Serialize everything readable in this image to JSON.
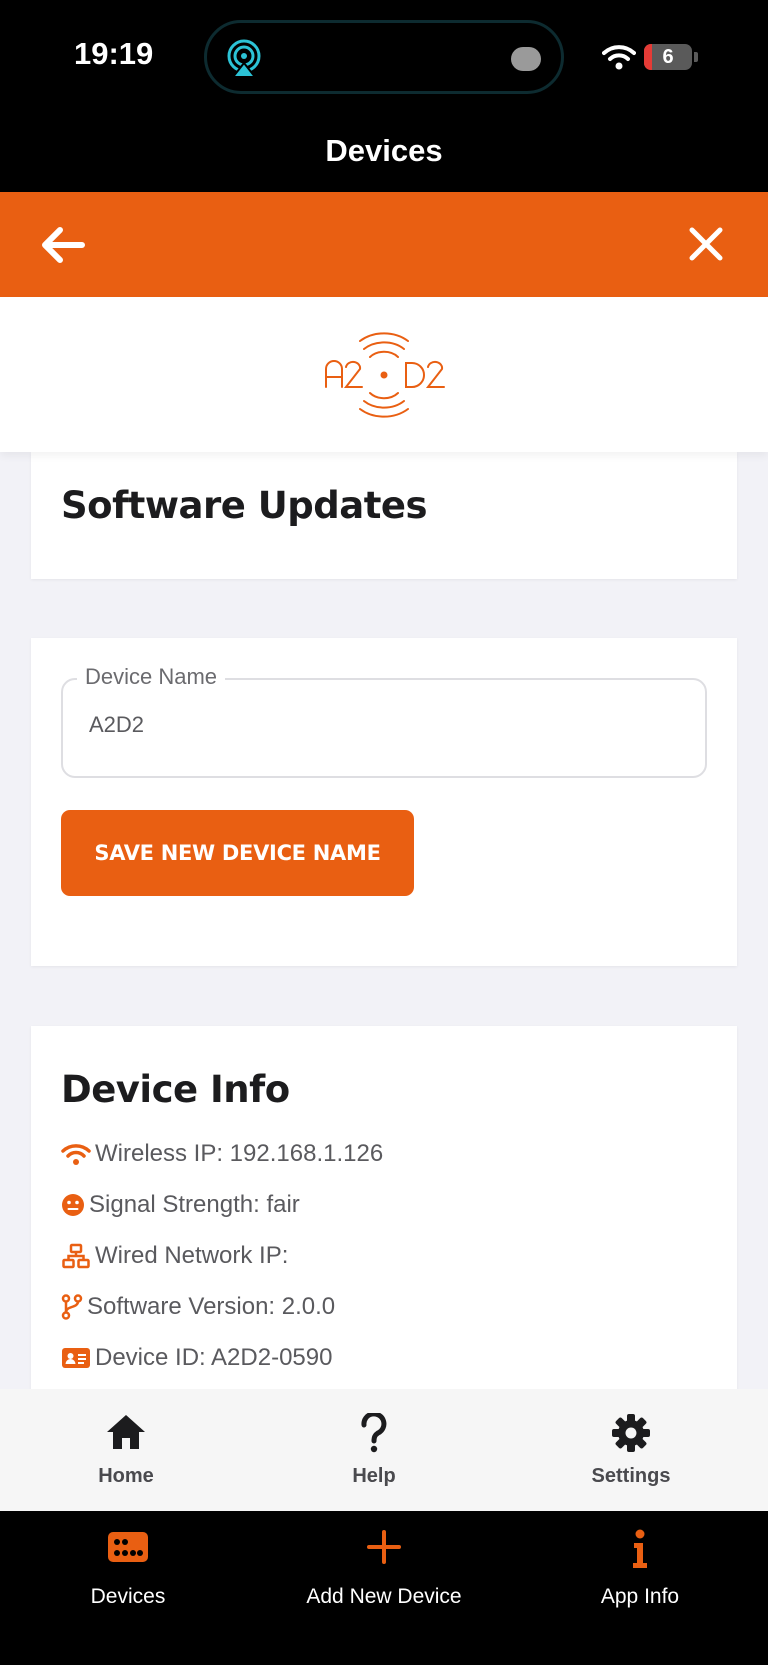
{
  "status_bar": {
    "time": "19:19",
    "battery": "6"
  },
  "header": {
    "title": "Devices"
  },
  "software_updates": {
    "title": "Software Updates"
  },
  "device_name": {
    "label": "Device Name",
    "value": "A2D2",
    "save_button": "SAVE NEW DEVICE NAME"
  },
  "device_info": {
    "title": "Device Info",
    "rows": [
      {
        "icon": "wifi-icon",
        "text": "Wireless IP: 192.168.1.126"
      },
      {
        "icon": "face-meh-icon",
        "text": "Signal Strength: fair"
      },
      {
        "icon": "network-icon",
        "text": "Wired Network IP:"
      },
      {
        "icon": "code-branch-icon",
        "text": "Software Version: 2.0.0"
      },
      {
        "icon": "id-card-icon",
        "text": "Device ID: A2D2-0590"
      }
    ]
  },
  "inner_tabs": [
    {
      "label": "Home",
      "icon": "home-icon"
    },
    {
      "label": "Help",
      "icon": "question-icon"
    },
    {
      "label": "Settings",
      "icon": "gear-icon"
    }
  ],
  "app_tabs": [
    {
      "label": "Devices",
      "icon": "devices-icon"
    },
    {
      "label": "Add New Device",
      "icon": "plus-icon"
    },
    {
      "label": "App Info",
      "icon": "info-icon"
    }
  ],
  "colors": {
    "accent": "#e95f12",
    "background": "#f2f2f7",
    "tab_text": "#4a4a4e"
  }
}
